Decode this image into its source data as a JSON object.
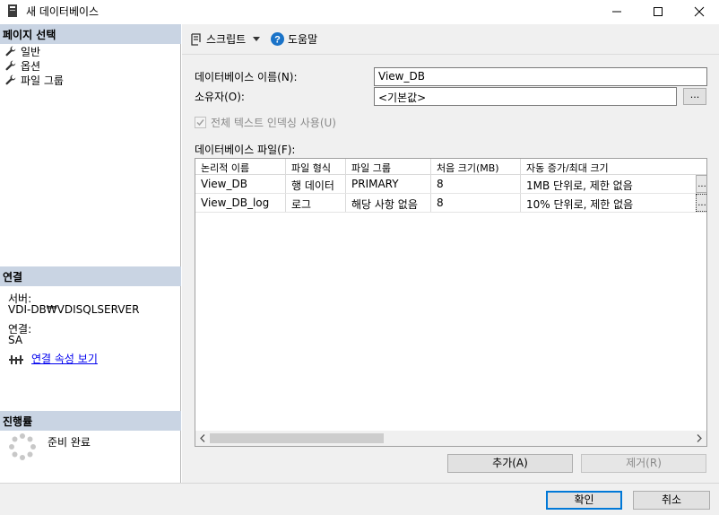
{
  "window": {
    "title": "새 데이터베이스",
    "controls": {
      "minimize": "minimize-icon",
      "maximize": "maximize-icon",
      "close": "close-icon"
    }
  },
  "left_pane": {
    "page_select_header": "페이지 선택",
    "pages": [
      {
        "label": "일반",
        "icon": "wrench-icon"
      },
      {
        "label": "옵션",
        "icon": "wrench-icon"
      },
      {
        "label": "파일 그룹",
        "icon": "wrench-icon"
      }
    ],
    "connection_header": "연결",
    "server_label": "서버:",
    "server_value": "VDI-DB₩VDISQLSERVER",
    "connection_label": "연결:",
    "connection_value": "SA",
    "view_connection_properties": "연결 속성 보기",
    "progress_header": "진행률",
    "progress_status": "준비 완료"
  },
  "toolbar": {
    "script_label": "스크립트",
    "help_label": "도움말"
  },
  "form": {
    "db_name_label": "데이터베이스 이름(N):",
    "db_name_value": "View_DB",
    "owner_label": "소유자(O):",
    "owner_value": "<기본값>",
    "owner_browse": "...",
    "fulltext_label": "전체 텍스트 인덱싱 사용(U)",
    "fulltext_checked": true,
    "files_label": "데이터베이스 파일(F):"
  },
  "files_grid": {
    "columns": [
      "논리적 이름",
      "파일 형식",
      "파일 그룹",
      "처음 크기(MB)",
      "자동 증가/최대 크기"
    ],
    "rows": [
      {
        "logical_name": "View_DB",
        "file_type": "행 데이터",
        "filegroup": "PRIMARY",
        "initial_size": "8",
        "autogrowth": "1MB 단위로, 제한 없음",
        "button": "..."
      },
      {
        "logical_name": "View_DB_log",
        "file_type": "로그",
        "filegroup": "해당 사항 없음",
        "initial_size": "8",
        "autogrowth": "10% 단위로, 제한 없음",
        "button": "..."
      }
    ]
  },
  "actions": {
    "add": "추가(A)",
    "remove": "제거(R)"
  },
  "dialog_buttons": {
    "ok": "확인",
    "cancel": "취소"
  },
  "colors": {
    "section_header": "#c9d4e3",
    "help_icon": "#1a73c8",
    "link": "#0000ee",
    "default_button_border": "#0078d7"
  }
}
